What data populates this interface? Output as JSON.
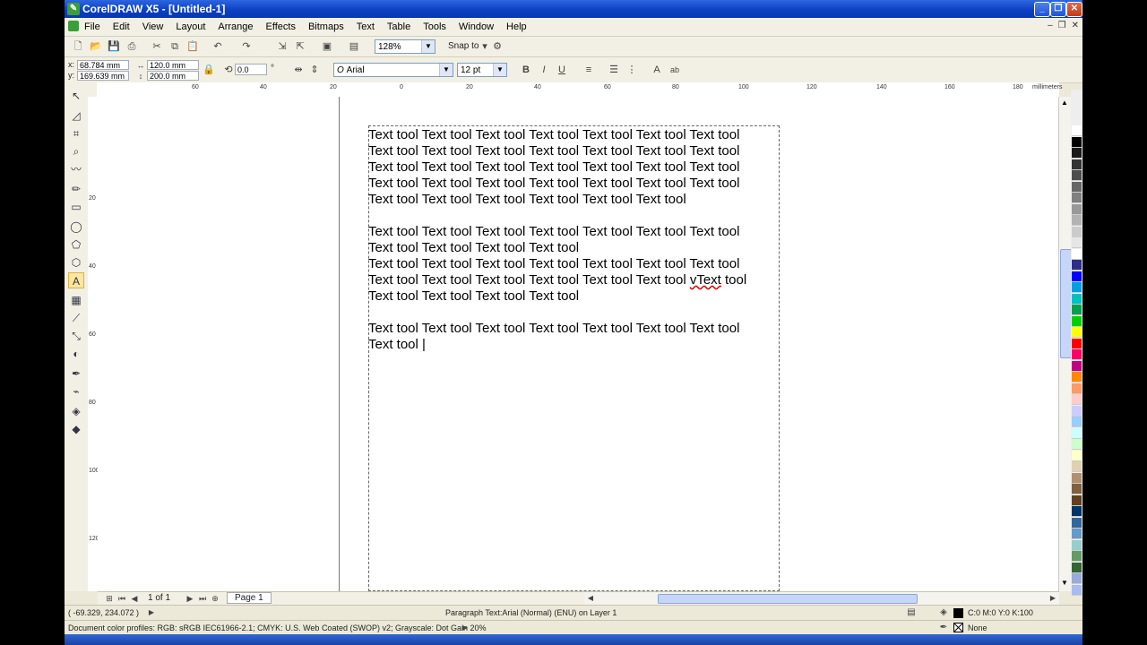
{
  "window": {
    "title": "CorelDRAW X5 - [Untitled-1]"
  },
  "menubar": {
    "items": [
      "File",
      "Edit",
      "View",
      "Layout",
      "Arrange",
      "Effects",
      "Bitmaps",
      "Text",
      "Table",
      "Tools",
      "Window",
      "Help"
    ]
  },
  "toolbar": {
    "zoom": "128%",
    "snap_to": "Snap to"
  },
  "property_bar": {
    "x": "68.784 mm",
    "y": "169.639 mm",
    "width": "120.0 mm",
    "height": "200.0 mm",
    "rotation": "0.0",
    "font_name": "Arial",
    "font_size": "12 pt"
  },
  "ruler": {
    "h_labels": [
      "60",
      "40",
      "20",
      "0",
      "20",
      "40",
      "60",
      "80",
      "100",
      "120",
      "140",
      "160",
      "180"
    ],
    "v_labels": [
      "20",
      "40",
      "60",
      "80",
      "100",
      "120"
    ],
    "units": "millimeters"
  },
  "paragraph_text": {
    "p1": [
      "Text tool Text tool Text tool Text tool Text tool Text tool Text tool",
      "Text tool Text tool Text tool Text tool Text tool Text tool Text tool",
      "Text tool Text tool Text tool Text tool Text tool Text tool Text tool",
      "Text tool Text tool Text tool Text tool Text tool Text tool Text tool",
      "Text tool Text tool Text tool Text tool Text tool Text tool"
    ],
    "p2": [
      "Text tool Text tool Text tool Text tool Text tool Text tool Text tool",
      "Text tool Text tool Text tool Text tool",
      "Text tool Text tool Text tool Text tool Text tool Text tool Text tool"
    ],
    "p2_line4_before": "Text tool Text tool Text tool Text tool Text tool Text tool ",
    "p2_line4_misspelled": "vText",
    "p2_line4_after": " tool",
    "p2_line5": "Text tool Text tool Text tool Text tool",
    "p3": [
      "Text tool Text tool Text tool Text tool Text tool Text tool Text tool",
      "Text tool |"
    ]
  },
  "page_nav": {
    "count": "1 of 1",
    "tab": "Page 1"
  },
  "status": {
    "coords": "( -69.329, 234.072 )",
    "object_info": "Paragraph Text:Arial (Normal) (ENU) on Layer 1",
    "fill_value": "C:0 M:0 Y:0 K:100",
    "outline_value": "None",
    "color_profiles": "Document color profiles: RGB: sRGB IEC61966-2.1; CMYK: U.S. Web Coated (SWOP) v2; Grayscale: Dot Gain 20%"
  },
  "palette": [
    "#ffffff",
    "#000000",
    "#1a1a1a",
    "#333333",
    "#4d4d4d",
    "#666666",
    "#808080",
    "#999999",
    "#b3b3b3",
    "#cccccc",
    "#e6e6e6",
    "#ffffff",
    "#2e2e8a",
    "#0000ff",
    "#00a0e0",
    "#00c0c0",
    "#00a050",
    "#00d000",
    "#ffff00",
    "#ff0000",
    "#ff0066",
    "#c00080",
    "#ff8800",
    "#ff9966",
    "#ffcccc",
    "#ccccff",
    "#99ccff",
    "#ccffff",
    "#ccffcc",
    "#ffffcc",
    "#e0d0b0",
    "#b09070",
    "#806040",
    "#604020",
    "#003366",
    "#336699",
    "#6699cc",
    "#99cccc",
    "#669966",
    "#336633",
    "#99aadd",
    "#aabbee"
  ]
}
